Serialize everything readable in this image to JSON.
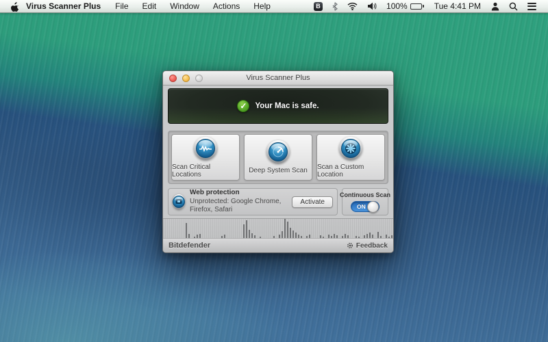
{
  "menu_bar": {
    "app_name": "Virus Scanner Plus",
    "menus": [
      "File",
      "Edit",
      "Window",
      "Actions",
      "Help"
    ],
    "status": {
      "bitdefender_icon_letter": "B",
      "battery_percent": "100%",
      "clock": "Tue 4:41 PM"
    }
  },
  "window": {
    "title": "Virus Scanner Plus",
    "banner": {
      "check_glyph": "✓",
      "message": "Your Mac is safe.",
      "status_color": "#58a929"
    },
    "scan_buttons": [
      {
        "label": "Scan Critical Locations",
        "icon": "waveform-scan-icon"
      },
      {
        "label": "Deep System Scan",
        "icon": "radar-scan-icon"
      },
      {
        "label": "Scan a Custom Location",
        "icon": "custom-location-scan-icon"
      }
    ],
    "web_protection": {
      "title": "Web protection",
      "subtitle": "Unprotected: Google Chrome, Firefox, Safari",
      "action_label": "Activate"
    },
    "continuous_scan": {
      "label": "Continuous Scan",
      "toggle_state": "ON",
      "toggle_color": "#3a86d4"
    },
    "activity_graph": {
      "bars": [
        0,
        0,
        0,
        0,
        0,
        0,
        0,
        0,
        22,
        6,
        0,
        2,
        5,
        6,
        0,
        0,
        0,
        0,
        0,
        0,
        0,
        3,
        5,
        0,
        0,
        0,
        0,
        0,
        0,
        20,
        26,
        12,
        7,
        4,
        0,
        2,
        0,
        0,
        0,
        0,
        3,
        0,
        5,
        10,
        28,
        24,
        15,
        11,
        8,
        5,
        3,
        0,
        3,
        5,
        0,
        0,
        0,
        4,
        2,
        0,
        5,
        3,
        6,
        4,
        0,
        3,
        6,
        4,
        0,
        0,
        3,
        2,
        0,
        4,
        6,
        8,
        5,
        0,
        9,
        3,
        0,
        5,
        2,
        4
      ]
    },
    "footer": {
      "brand": "Bitdefender",
      "feedback_label": "Feedback"
    }
  }
}
